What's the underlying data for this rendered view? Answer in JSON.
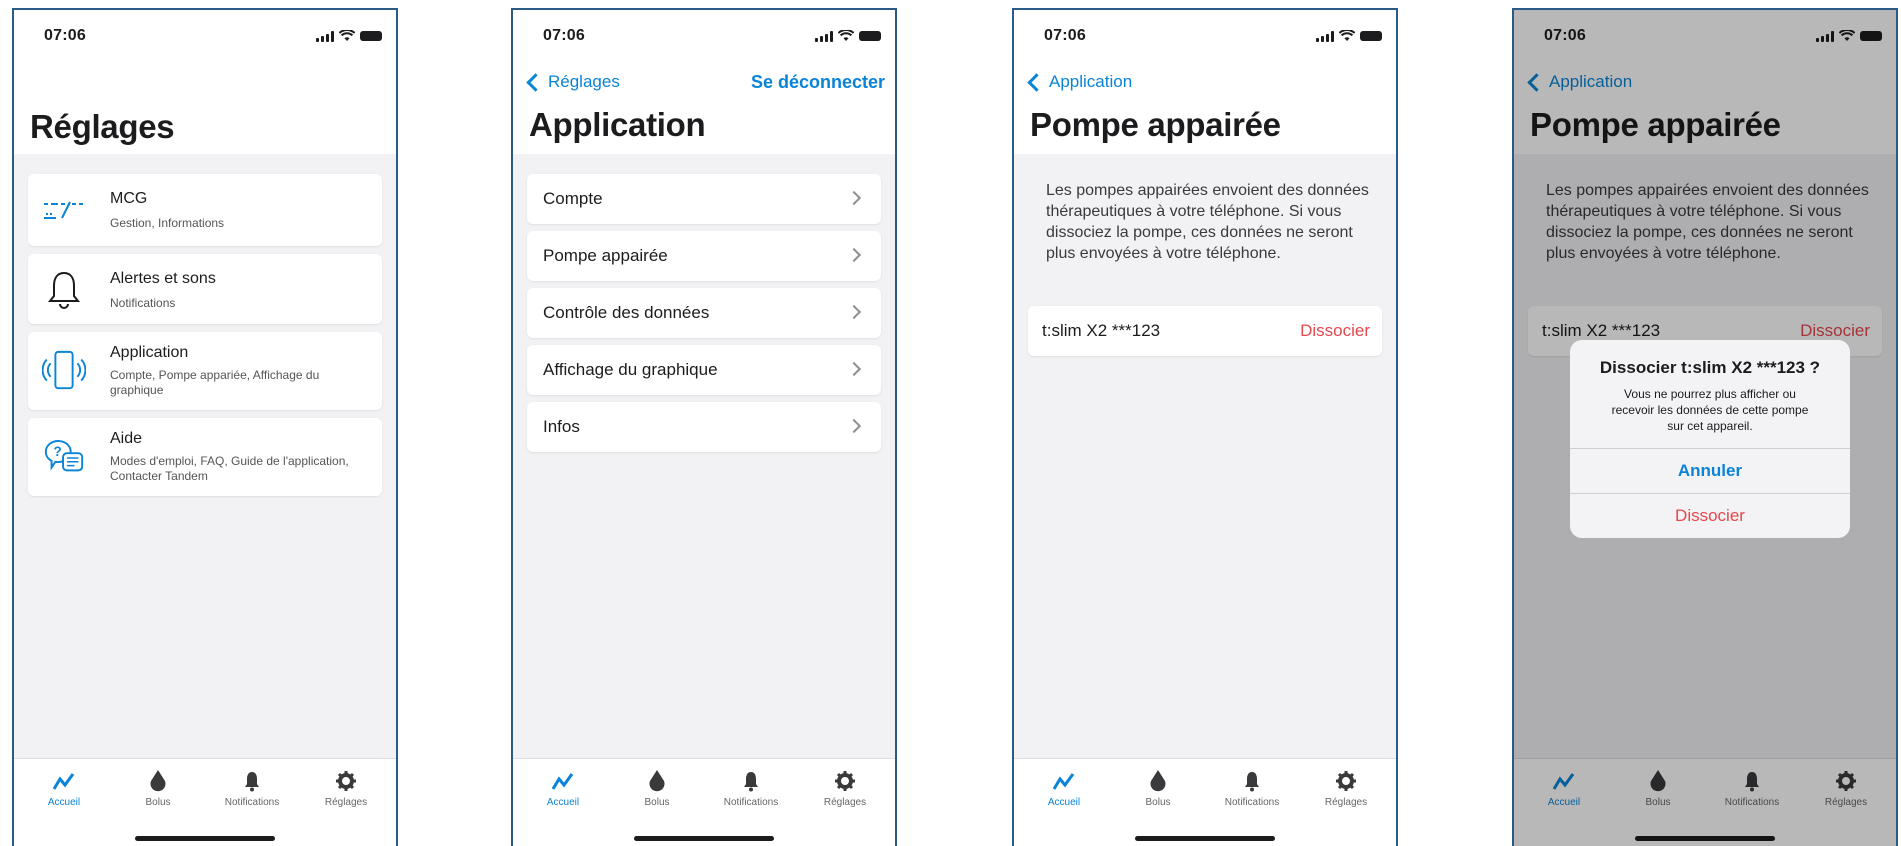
{
  "status_time": "07:06",
  "tabs": [
    {
      "label": "Accueil",
      "icon": "graph-icon"
    },
    {
      "label": "Bolus",
      "icon": "drop-icon"
    },
    {
      "label": "Notifications",
      "icon": "bell-icon"
    },
    {
      "label": "Réglages",
      "icon": "gear-icon"
    }
  ],
  "screen1": {
    "title": "Réglages",
    "items": [
      {
        "title": "MCG",
        "subtitle": "Gestion, Informations",
        "icon": "cgm-trend-icon"
      },
      {
        "title": "Alertes et sons",
        "subtitle": "Notifications",
        "icon": "bell-icon"
      },
      {
        "title": "Application",
        "subtitle": "Compte, Pompe appariée, Affichage du graphique",
        "icon": "phone-signal-icon"
      },
      {
        "title": "Aide",
        "subtitle": "Modes d'emploi, FAQ, Guide de l'application, Contacter Tandem",
        "icon": "help-chat-icon"
      }
    ]
  },
  "screen2": {
    "back": "Réglages",
    "action": "Se déconnecter",
    "title": "Application",
    "items": [
      "Compte",
      "Pompe appairée",
      "Contrôle des données",
      "Affichage du graphique",
      "Infos"
    ]
  },
  "screen3": {
    "back": "Application",
    "title": "Pompe appairée",
    "description": "Les pompes appairées envoient des données thérapeutiques à votre téléphone. Si vous dissociez la pompe, ces données ne seront plus envoyées à votre téléphone.",
    "pump_name": "t:slim X2 ***123",
    "dissociate": "Dissocier"
  },
  "screen4": {
    "back": "Application",
    "title": "Pompe appairée",
    "description": "Les pompes appairées envoient des données thérapeutiques à votre téléphone. Si vous dissociez la pompe, ces données ne seront plus envoyées à votre téléphone.",
    "pump_name": "t:slim X2 ***123",
    "dissociate": "Dissocier",
    "alert": {
      "title": "Dissocier t:slim X2 ***123 ?",
      "message": "Vous ne pourrez plus afficher ou recevoir les données de cette pompe sur cet appareil.",
      "cancel": "Annuler",
      "confirm": "Dissocier"
    }
  },
  "colors": {
    "accent": "#0a84d6",
    "destructive": "#e5484d",
    "frame": "#2c5a86"
  }
}
